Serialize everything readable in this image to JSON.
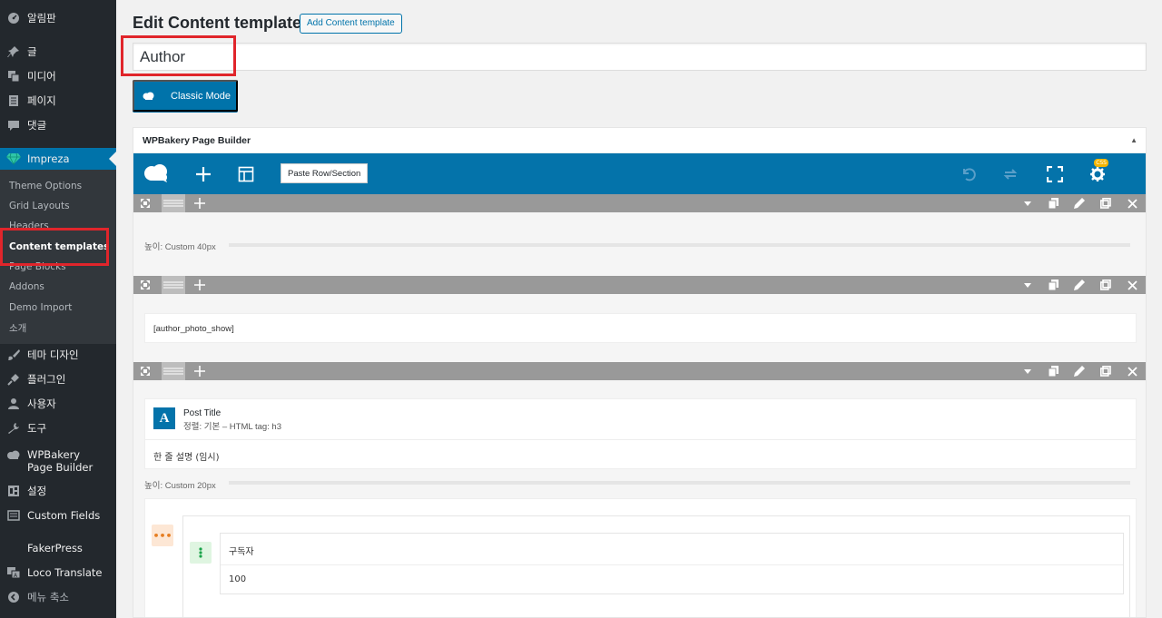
{
  "sidebar": {
    "items": [
      {
        "label": "알림판",
        "icon": "dashboard-icon"
      },
      {
        "label": "글",
        "icon": "pushpin-icon"
      },
      {
        "label": "미디어",
        "icon": "media-icon"
      },
      {
        "label": "페이지",
        "icon": "page-icon"
      },
      {
        "label": "댓글",
        "icon": "comment-icon"
      },
      {
        "label": "Impreza",
        "icon": "diamond-icon"
      },
      {
        "label": "테마 디자인",
        "icon": "brush-icon"
      },
      {
        "label": "플러그인",
        "icon": "plugin-icon"
      },
      {
        "label": "사용자",
        "icon": "user-icon"
      },
      {
        "label": "도구",
        "icon": "wrench-icon"
      },
      {
        "label": "WPBakery Page Builder",
        "icon": "cloud-icon"
      },
      {
        "label": "설정",
        "icon": "settings-icon"
      },
      {
        "label": "Custom Fields",
        "icon": "fields-icon"
      },
      {
        "label": "FakerPress",
        "icon": ""
      },
      {
        "label": "Loco Translate",
        "icon": "translate-icon"
      },
      {
        "label": "메뉴 축소",
        "icon": "collapse-icon"
      }
    ],
    "submenu": [
      {
        "label": "Theme Options"
      },
      {
        "label": "Grid Layouts"
      },
      {
        "label": "Headers"
      },
      {
        "label": "Content templates"
      },
      {
        "label": "Page Blocks"
      },
      {
        "label": "Addons"
      },
      {
        "label": "Demo Import"
      },
      {
        "label": "소개"
      }
    ]
  },
  "header": {
    "title": "Edit Content template",
    "add_button": "Add Content template"
  },
  "title_field": {
    "value": "Author"
  },
  "classic_mode_button": "Classic Mode",
  "wpbakery": {
    "panel_title": "WPBakery Page Builder",
    "paste_button": "Paste Row/Section",
    "css_badge": "CSS",
    "rows": [
      {
        "spacer_label": "높이: Custom  40px"
      },
      {
        "shortcode": "[author_photo_show]"
      },
      {
        "post_title": {
          "name": "Post Title",
          "meta": "정렬: 기본  – HTML tag: h3"
        },
        "text": "한 줄 설명 (임시)",
        "spacer_label": "높이: Custom  20px",
        "nested": {
          "label": "구독자",
          "value": "100"
        }
      }
    ]
  },
  "colors": {
    "accent": "#0073aa",
    "sidebar_bg": "#23282d",
    "highlight_box": "#e0252b"
  }
}
